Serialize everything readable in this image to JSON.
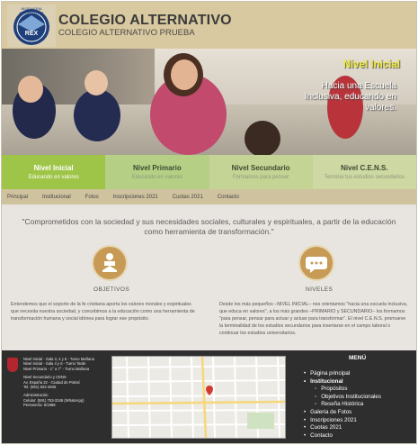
{
  "header": {
    "logo_lettering": [
      "INGENIERIA",
      "INFORMATICA",
      "REX"
    ],
    "title": "COLEGIO ALTERNATIVO",
    "subtitle": "COLEGIO ALTERNATIVO PRUEBA"
  },
  "hero": {
    "title": "Nivel Inicial",
    "slogan": "Hacia una Escuela Inclusiva, educando en valores."
  },
  "levels": [
    {
      "title": "Nivel Inicial",
      "subtitle": "Educando en valores"
    },
    {
      "title": "Nivel Primario",
      "subtitle": "Educando en valores"
    },
    {
      "title": "Nivel Secundario",
      "subtitle": "Formamos para pensar"
    },
    {
      "title": "Nivel C.E.N.S.",
      "subtitle": "Terminá tus estudios secundarios"
    }
  ],
  "nav": [
    "Principal",
    "Institucional",
    "Fotos",
    "Inscripciones 2021",
    "Cuotas 2021",
    "Contacto"
  ],
  "main": {
    "quote": "\"Comprometidos con la sociedad y sus necesidades sociales, culturales y espirituales, a partir de la educación como herramienta de transformación.\"",
    "objetivos": {
      "title": "OBJETIVOS",
      "text": "Entendemos que el soporte de la fe cristiana aporta los valores morales y espirituales que necesita nuestra sociedad, y concebimos a la educación como una herramienta de transformación humana y social idónea para lograr ese propósito.",
      "icon": "reading-person-icon"
    },
    "niveles": {
      "title": "NIVELES",
      "text": "Desde los más pequeños –NIVEL INICIAL– nos orientamos \"hacia una escuela inclusiva, que educa en valores\", a los más grandes –PRIMARIO y SECUNDARIO– los formamos \"para pensar, pensar para actuar y actuar para transformar\". El nivel C.E.N.S. promueve la terminalidad de los estudios secundarios para insertarse en el campo laboral o continuar los estudios universitarios.",
      "icon": "speech-bubble-icon"
    }
  },
  "footer": {
    "levels_info": [
      "Nivel Inicial - Sala 3, 4 y 5 - Turno Mañana",
      "Nivel Inicial - Sala 4 y 5 - Turno Tarde",
      "Nivel Primario - 1° a 7° - Turno Mañana"
    ],
    "address": [
      "Nivel Secundario y CENS",
      "Av. España 22 - Ciudad de Potosí",
      "Tel. (591) 622-4845"
    ],
    "admin": [
      "Administración",
      "Celular: (591) 753-3346 (WhatsApp)",
      "Personería: 5/1986"
    ],
    "menu_title": "MENÚ",
    "menu": [
      {
        "label": "Página principal",
        "level": 0,
        "bold": false
      },
      {
        "label": "Institucional",
        "level": 0,
        "bold": true
      },
      {
        "label": "Propósitos",
        "level": 1,
        "bold": false
      },
      {
        "label": "Objetivos Institucionales",
        "level": 1,
        "bold": false
      },
      {
        "label": "Reseña Histórica",
        "level": 1,
        "bold": false
      },
      {
        "label": "Galería de Fotos",
        "level": 0,
        "bold": false
      },
      {
        "label": "Inscripciones 2021",
        "level": 0,
        "bold": false
      },
      {
        "label": "Cuotas 2021",
        "level": 0,
        "bold": false
      },
      {
        "label": "Contacto",
        "level": 0,
        "bold": false
      }
    ]
  },
  "colors": {
    "header_bg": "#d9c9a0",
    "level_active": "#9fc548",
    "hero_title": "#f0e93a",
    "icon_circle": "#c79a55",
    "footer_bg": "#2e2e2e"
  }
}
